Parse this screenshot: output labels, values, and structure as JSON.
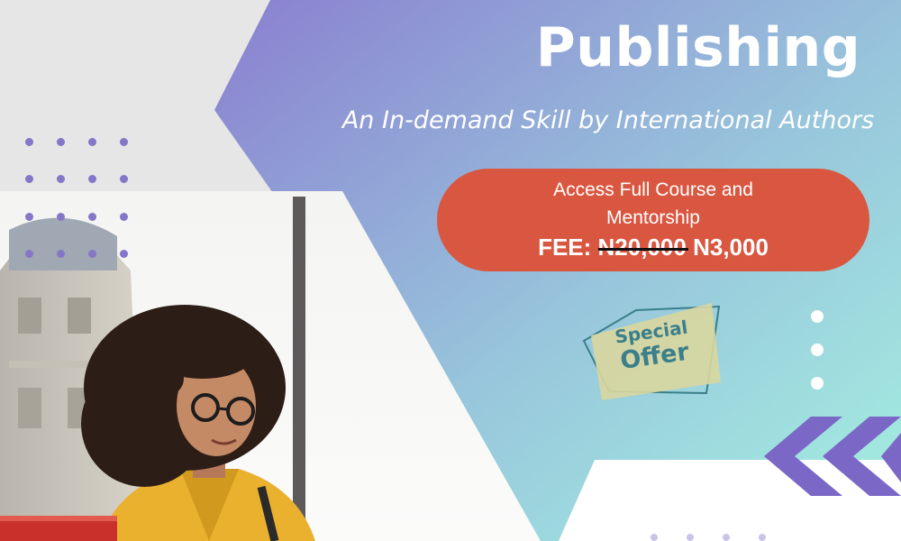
{
  "title": "Publishing",
  "subtitle": "An In-demand Skill by International Authors",
  "offer": {
    "line1": "Access Full Course and",
    "line2": "Mentorship",
    "fee_label": "FEE:",
    "old_price": "N20,000",
    "new_price": "N3,000"
  },
  "badge": {
    "line1": "Special",
    "line2": "Offer"
  },
  "colors": {
    "gradient_start": "#8a7fd0",
    "gradient_end": "#a4f0e0",
    "pill": "#d95740",
    "chevron": "#7b68c6",
    "badge_fill": "#d8d6a0",
    "badge_text": "#3b7f8a"
  },
  "photo": {
    "description_icon": "woman-with-books-photo"
  }
}
